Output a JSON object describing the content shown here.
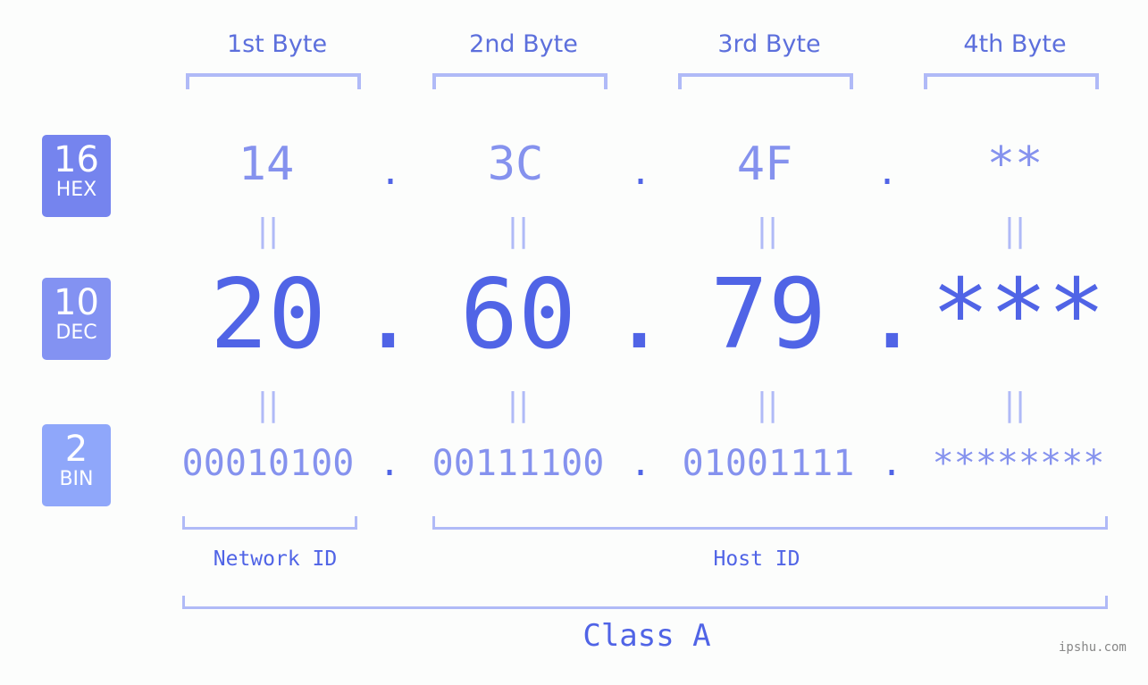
{
  "bytes": [
    {
      "label": "1st Byte",
      "hex": "14",
      "dec": "20",
      "bin": "00010100"
    },
    {
      "label": "2nd Byte",
      "hex": "3C",
      "dec": "60",
      "bin": "00111100"
    },
    {
      "label": "3rd Byte",
      "hex": "4F",
      "dec": "79",
      "bin": "01001111"
    },
    {
      "label": "4th Byte",
      "hex": "**",
      "dec": "***",
      "bin": "********"
    }
  ],
  "separator": ".",
  "equals": "||",
  "bases": {
    "hex": {
      "num": "16",
      "label": "HEX",
      "color": "#7584ee"
    },
    "dec": {
      "num": "10",
      "label": "DEC",
      "color": "#8392f2"
    },
    "bin": {
      "num": "2",
      "label": "BIN",
      "color": "#8fa7fa"
    }
  },
  "network_id": "Network ID",
  "host_id": "Host ID",
  "class_label": "Class A",
  "watermark": "ipshu.com"
}
